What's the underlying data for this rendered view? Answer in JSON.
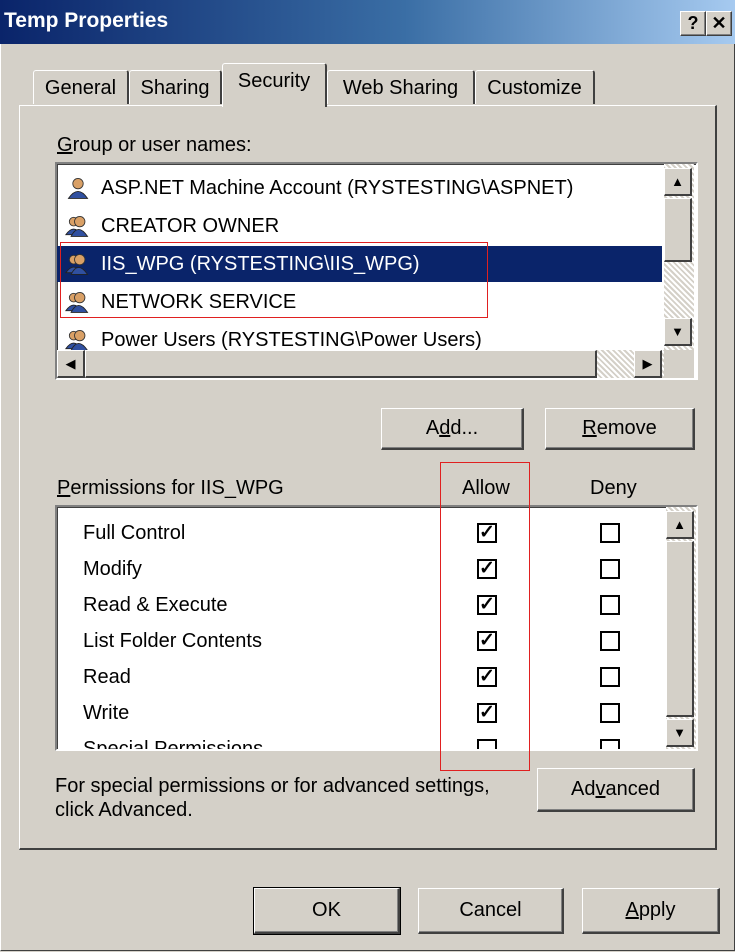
{
  "window": {
    "title": "Temp Properties",
    "help_glyph": "?",
    "close_glyph": "✕"
  },
  "tabs": [
    {
      "label": "General"
    },
    {
      "label": "Sharing"
    },
    {
      "label": "Security",
      "active": true
    },
    {
      "label": "Web Sharing"
    },
    {
      "label": "Customize"
    }
  ],
  "groups": {
    "label_first": "G",
    "label_rest": "roup or user names:",
    "items": [
      {
        "name": "ASP.NET Machine Account (RYSTESTING\\ASPNET)",
        "icon": "single-user-icon"
      },
      {
        "name": "CREATOR OWNER",
        "icon": "group-icon"
      },
      {
        "name": "IIS_WPG (RYSTESTING\\IIS_WPG)",
        "icon": "group-icon",
        "selected": true
      },
      {
        "name": "NETWORK SERVICE",
        "icon": "group-icon"
      },
      {
        "name": "Power Users (RYSTESTING\\Power Users)",
        "icon": "group-icon"
      }
    ]
  },
  "buttons": {
    "add_pre": "A",
    "add_u": "d",
    "add_post": "d...",
    "remove_u": "R",
    "remove_post": "emove",
    "advanced_pre": "Ad",
    "advanced_u": "v",
    "advanced_post": "anced",
    "ok": "OK",
    "cancel": "Cancel",
    "apply_u": "A",
    "apply_post": "pply"
  },
  "permissions": {
    "label_u": "P",
    "label_rest": "ermissions for IIS_WPG",
    "allow_header": "Allow",
    "deny_header": "Deny",
    "rows": [
      {
        "name": "Full Control",
        "allow": true,
        "deny": false
      },
      {
        "name": "Modify",
        "allow": true,
        "deny": false
      },
      {
        "name": "Read & Execute",
        "allow": true,
        "deny": false
      },
      {
        "name": "List Folder Contents",
        "allow": true,
        "deny": false
      },
      {
        "name": "Read",
        "allow": true,
        "deny": false
      },
      {
        "name": "Write",
        "allow": true,
        "deny": false
      },
      {
        "name": "Special Permissions",
        "allow": false,
        "deny": false
      }
    ]
  },
  "advanced_note": "For special permissions or for advanced settings, click Advanced.",
  "colors": {
    "selection": "#0a246a",
    "highlight_box": "#e02020",
    "face": "#d4d0c8"
  }
}
